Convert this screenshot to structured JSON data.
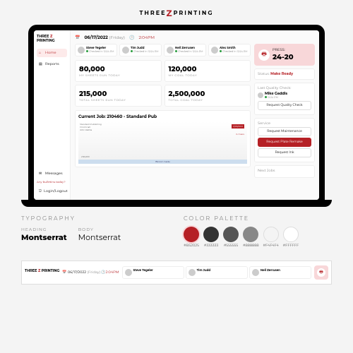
{
  "brand": {
    "text1": "THREE",
    "text2": "PRINTING"
  },
  "sidebar": {
    "logo1": "THREE",
    "logo2": "PRINTING",
    "items": [
      {
        "icon": "home-icon",
        "label": "Home"
      },
      {
        "icon": "file-icon",
        "label": "Reports"
      }
    ],
    "divider": "",
    "msg": {
      "icon": "message-icon",
      "label": "Messages"
    },
    "notice": "Any bulletins today?",
    "logout": "Login/Logout"
  },
  "header": {
    "date": "06/17/2022",
    "day": "(Friday)",
    "time": "2:04PM"
  },
  "people": [
    {
      "name": "Steve Tegeler",
      "status": "Checked in",
      "time": "12:24 PM"
    },
    {
      "name": "Tim Judd",
      "status": "Checked in",
      "time": "12:24 PM"
    },
    {
      "name": "Neil Zerrusen",
      "status": "Checked in",
      "time": "12:24 PM"
    },
    {
      "name": "Alex Smith",
      "status": "Checked in",
      "time": "12:24 PM"
    }
  ],
  "metrics": [
    {
      "value": "80,000",
      "label": "MY SHEETS RUN TODAY"
    },
    {
      "value": "120,000",
      "label": "MY GOAL TODAY"
    },
    {
      "value": "215,000",
      "label": "TOTAL SHEETS RUN TODAY"
    },
    {
      "value": "2,500,000",
      "label": "TOTAL GOAL TODAY"
    }
  ],
  "job": {
    "title_prefix": "Current Job:",
    "title": "210460 - Standard Pub",
    "customer": "Standard Publishing",
    "contact": "John Rettle",
    "city": "Cincinnati",
    "state": "OH",
    "zip": "45249",
    "badge": "11/05/2021",
    "bluebar": "Bind-In Cards",
    "overs": "% Overs",
    "qty": "236,900"
  },
  "press": {
    "label": "PRESS:",
    "number": "24-20"
  },
  "status": {
    "label": "Status:",
    "value": "Make Ready"
  },
  "qc": {
    "title": "Last Quality Check:",
    "name": "Mike Gaddis",
    "time": "12:24 PM",
    "btn": "Request Quality Check"
  },
  "service": {
    "title": "Service",
    "btn1": "Request Maintenance",
    "btn2": "Request Plate Remake",
    "btn3": "Request Ink"
  },
  "next": {
    "title": "Next Jobs"
  },
  "typography": {
    "heading": "TYPOGRAPHY",
    "h_label": "HEADING",
    "h_font": "Montserrat",
    "b_label": "BODY",
    "b_font": "Montserrat"
  },
  "palette": {
    "heading": "COLOR PALETTE",
    "colors": [
      "#B52025",
      "#333333",
      "#555555",
      "#888888",
      "#F4F4F4",
      "#FFFFFF"
    ]
  }
}
